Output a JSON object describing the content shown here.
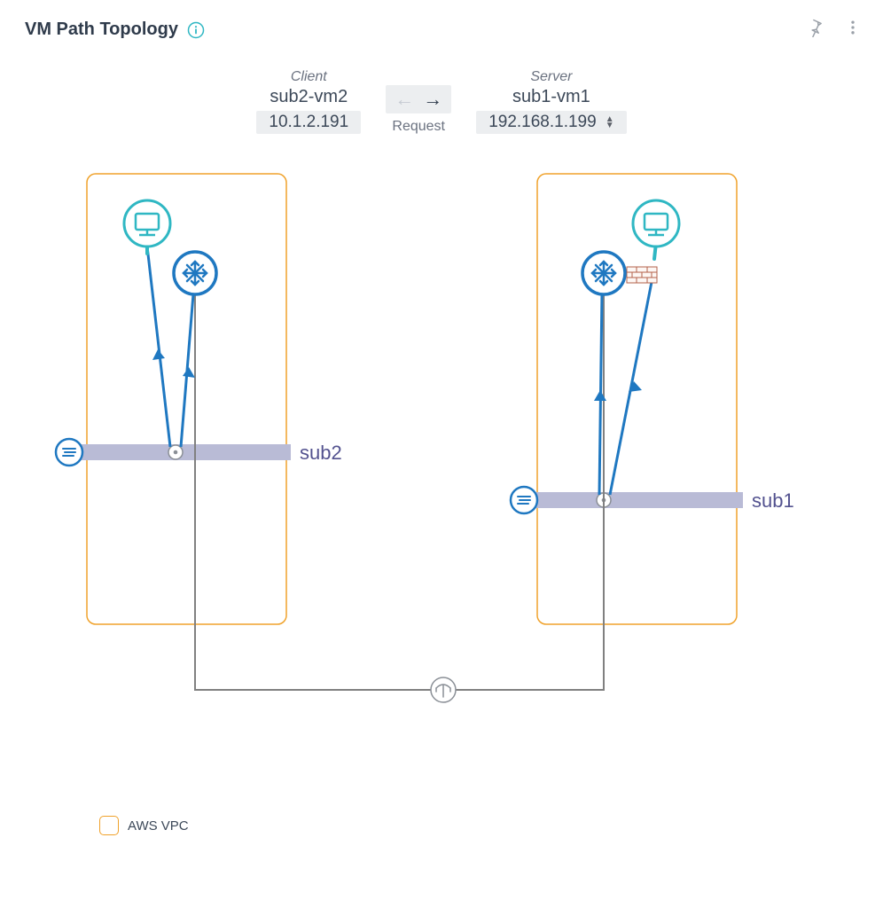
{
  "title": "VM Path Topology",
  "client": {
    "role": "Client",
    "name": "sub2-vm2",
    "ip": "10.1.2.191"
  },
  "server": {
    "role": "Server",
    "name": "sub1-vm1",
    "ip": "192.168.1.199"
  },
  "direction_label": "Request",
  "subnets": {
    "left": "sub2",
    "right": "sub1"
  },
  "legend": {
    "aws_vpc": "AWS VPC"
  },
  "icons": {
    "info": "info-icon",
    "pin": "pin-icon",
    "kebab": "kebab-icon",
    "vm": "monitor-icon",
    "router": "router-icon",
    "subnet_badge": "list-icon",
    "firewall": "firewall-icon",
    "junction": "junction-icon"
  }
}
